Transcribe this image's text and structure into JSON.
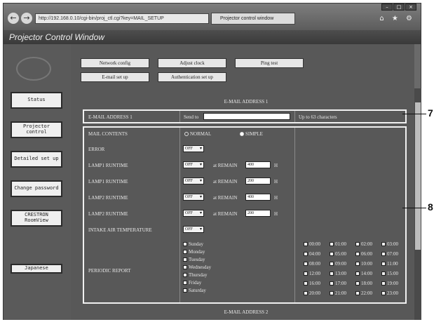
{
  "browser": {
    "address": "http://192.168.0.10/cgi-bin/proj_ctl.cgi?key=MAIL_SETUP",
    "tab_title": "Projector control window",
    "back_glyph": "←",
    "forward_glyph": "→",
    "tool_icons": "⌂ ★ ⚙",
    "win_buttons": [
      "–",
      "□",
      "×"
    ]
  },
  "window_title": "Projector Control Window",
  "sidebar": {
    "buttons": [
      {
        "id": "status",
        "label": "Status"
      },
      {
        "id": "projector-control",
        "label": "Projector control"
      },
      {
        "id": "detailed-setup",
        "label": "Detailed set up"
      },
      {
        "id": "change-password",
        "label": "Change password"
      },
      {
        "id": "crestron",
        "label": "CRESTRON RoomView"
      },
      {
        "id": "japanese",
        "label": "Japanese"
      }
    ]
  },
  "tabs": {
    "network_config": "Network config",
    "adjust_clock": "Adjust clock",
    "ping_test": "Ping test",
    "email_setup": "E-mail set up",
    "auth_setup": "Authentication set up"
  },
  "section1_title": "E-MAIL ADDRESS 1",
  "email_row": {
    "label": "E-MAIL ADDRESS 1",
    "send_to": "Send to",
    "value": "",
    "hint": "Up to 63 characters"
  },
  "mail_contents": {
    "label": "MAIL CONTENTS",
    "normal": "NORMAL",
    "simple": "SIMPLE",
    "selected": "SIMPLE"
  },
  "settings": [
    {
      "label": "ERROR",
      "value": "OFF"
    },
    {
      "label": "LAMP1 RUNTIME",
      "value": "OFF",
      "remain_label": "at REMAIN",
      "remain": "400",
      "unit": "H"
    },
    {
      "label": "LAMP1 RUNTIME",
      "value": "OFF",
      "remain_label": "at REMAIN",
      "remain": "200",
      "unit": "H"
    },
    {
      "label": "LAMP2 RUNTIME",
      "value": "OFF",
      "remain_label": "at REMAIN",
      "remain": "400",
      "unit": "H"
    },
    {
      "label": "LAMP2 RUNTIME",
      "value": "OFF",
      "remain_label": "at REMAIN",
      "remain": "200",
      "unit": "H"
    },
    {
      "label": "INTAKE AIR TEMPERATURE",
      "value": "OFF"
    }
  ],
  "periodic_report": {
    "label": "PERIODIC REPORT",
    "days": [
      "Sunday",
      "Monday",
      "Tuesday",
      "Wednesday",
      "Thursday",
      "Friday",
      "Saturday"
    ],
    "times": [
      "00:00",
      "01:00",
      "02:00",
      "03:00",
      "04:00",
      "05:00",
      "06:00",
      "07:00",
      "08:00",
      "09:00",
      "10:00",
      "11:00",
      "12:00",
      "13:00",
      "14:00",
      "15:00",
      "16:00",
      "17:00",
      "18:00",
      "19:00",
      "20:00",
      "21:00",
      "22:00",
      "23:00"
    ]
  },
  "section2_title": "E-MAIL ADDRESS 2",
  "callouts": [
    "7",
    "8"
  ]
}
